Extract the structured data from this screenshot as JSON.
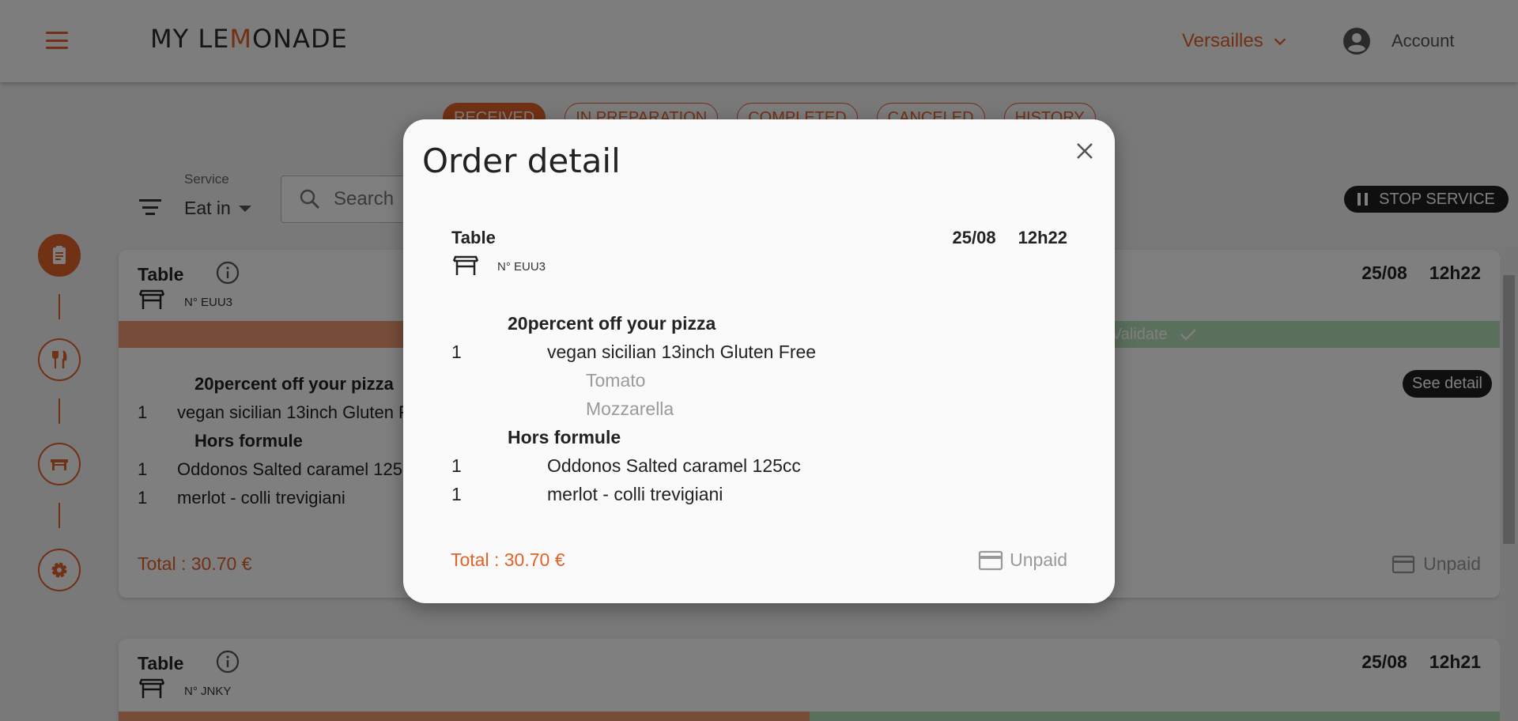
{
  "header": {
    "logo": {
      "part1": "MY LE",
      "part2": "M",
      "part3": "ONADE"
    },
    "city": "Versailles",
    "account_label": "Account"
  },
  "tabs": [
    {
      "label": "RECEIVED",
      "active": true
    },
    {
      "label": "IN PREPARATION",
      "active": false
    },
    {
      "label": "COMPLETED",
      "active": false
    },
    {
      "label": "CANCELED",
      "active": false
    },
    {
      "label": "HISTORY",
      "active": false
    }
  ],
  "filters": {
    "service_label": "Service",
    "service_value": "Eat in",
    "search_placeholder": "Search"
  },
  "stop_service_label": "STOP SERVICE",
  "orders": [
    {
      "title": "Table",
      "table_no": "N° EUU3",
      "date": "25/08",
      "time": "12h22",
      "validate_label": "Validate",
      "see_detail_label": "See detail",
      "items": {
        "cat1": "20percent off your pizza",
        "line1_qty": "1",
        "line1_name": "vegan sicilian 13inch Gluten Free",
        "cat2": "Hors formule",
        "line2_qty": "1",
        "line2_name": "Oddonos Salted caramel 125cc",
        "line3_qty": "1",
        "line3_name": "merlot - colli trevigiani"
      },
      "total": "Total : 30.70 €",
      "payment_status": "Unpaid"
    },
    {
      "title": "Table",
      "table_no": "N° JNKY",
      "date": "25/08",
      "time": "12h21"
    }
  ],
  "modal": {
    "heading": "Order detail",
    "title": "Table",
    "table_no": "N° EUU3",
    "date": "25/08",
    "time": "12h22",
    "cat1": "20percent off your pizza",
    "line1_qty": "1",
    "line1_name": "vegan sicilian 13inch Gluten Free",
    "opt1": "Tomato",
    "opt2": "Mozzarella",
    "cat2": "Hors formule",
    "line2_qty": "1",
    "line2_name": "Oddonos Salted caramel 125cc",
    "line3_qty": "1",
    "line3_name": "merlot - colli trevigiani",
    "total": "Total : 30.70 €",
    "payment_status": "Unpaid"
  },
  "colors": {
    "accent": "#e2622b",
    "validate": "#b6e0b8",
    "dark_button": "#1f1f1f"
  },
  "icons": [
    "menu-icon",
    "chevron-down-icon",
    "account-circle-icon",
    "filter-icon",
    "search-icon",
    "pause-icon",
    "orders-icon",
    "fork-knife-icon",
    "table-icon",
    "gear-icon",
    "info-icon",
    "check-icon",
    "credit-card-icon",
    "close-icon"
  ]
}
